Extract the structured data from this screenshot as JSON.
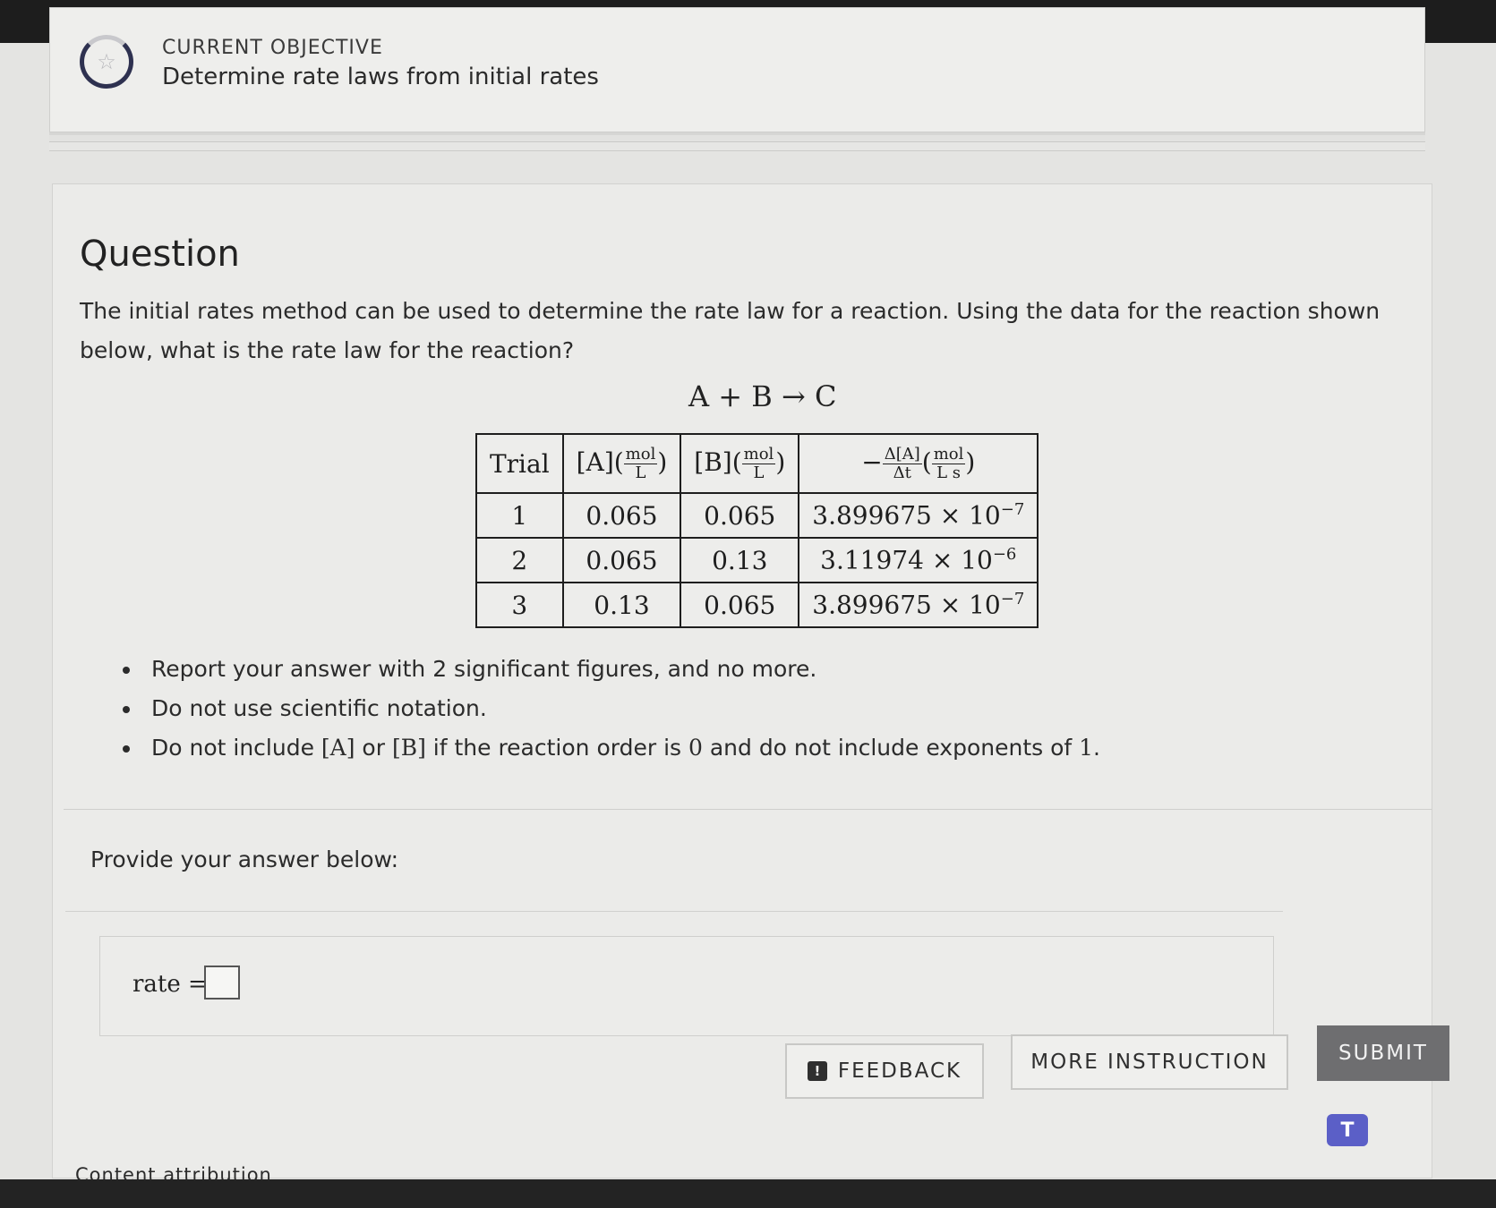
{
  "objective": {
    "label": "CURRENT OBJECTIVE",
    "title": "Determine rate laws from initial rates",
    "icon": "star-icon"
  },
  "question": {
    "heading": "Question",
    "text": "The initial rates method can be used to determine the rate law for a reaction. Using the data for the reaction shown below, what is the rate law for the reaction?",
    "equation": "A + B → C"
  },
  "table": {
    "headers": {
      "trial": "Trial",
      "a_label": "[A](",
      "b_label": "[B](",
      "rate_prefix": "−",
      "rate_num": "Δ[A]",
      "rate_den": "Δt",
      "unit_num": "mol",
      "unit_den": "L",
      "rate_unit_den": "L s",
      "close": ")"
    },
    "rows": [
      {
        "trial": "1",
        "a": "0.065",
        "b": "0.065",
        "rate_mantissa": "3.899675 × 10",
        "rate_exp": "−7"
      },
      {
        "trial": "2",
        "a": "0.065",
        "b": "0.13",
        "rate_mantissa": "3.11974 × 10",
        "rate_exp": "−6"
      },
      {
        "trial": "3",
        "a": "0.13",
        "b": "0.065",
        "rate_mantissa": "3.899675 × 10",
        "rate_exp": "−7"
      }
    ]
  },
  "instructions": {
    "item1": "Report your answer with 2 significant figures, and no more.",
    "item2": "Do not use scientific notation.",
    "item3_part1": "Do not include ",
    "item3_a": "[A]",
    "item3_part2": " or ",
    "item3_b": "[B]",
    "item3_part3": " if the reaction order is ",
    "item3_zero": "0",
    "item3_part4": " and do not include exponents of ",
    "item3_one": "1",
    "item3_end": "."
  },
  "answer": {
    "prompt": "Provide your answer below:",
    "rate_label": "rate =",
    "value": ""
  },
  "buttons": {
    "feedback": "FEEDBACK",
    "feedback_icon": "!",
    "more_instruction": "MORE INSTRUCTION",
    "submit": "SUBMIT"
  },
  "footer": {
    "attribution": "Content attribution",
    "teams_icon_glyph": "T"
  }
}
